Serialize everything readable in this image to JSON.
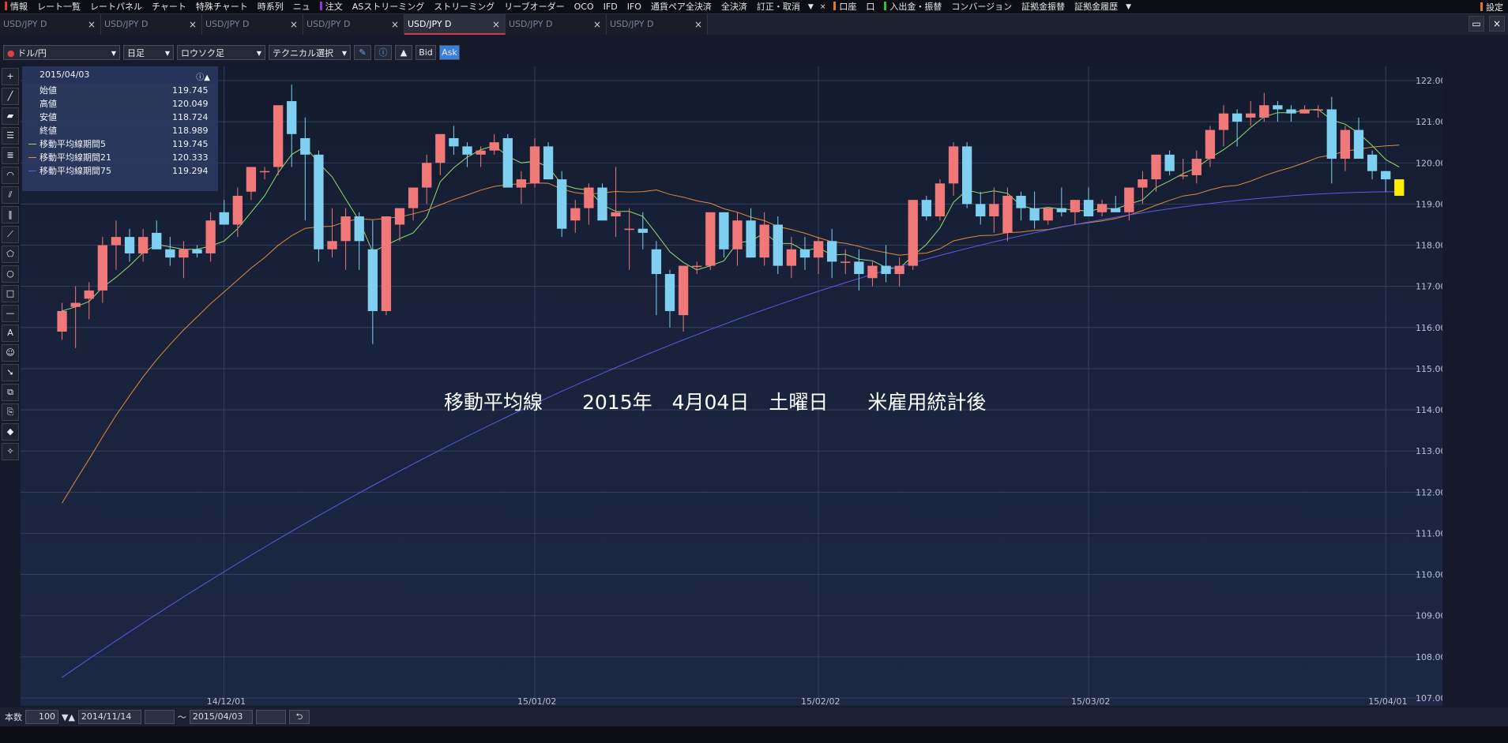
{
  "menubar": {
    "items": [
      {
        "label": "情報",
        "mark": "#d93b3b"
      },
      {
        "label": "レート一覧"
      },
      {
        "label": "レートパネル"
      },
      {
        "label": "チャート"
      },
      {
        "label": "特殊チャート"
      },
      {
        "label": "時系列"
      },
      {
        "label": "ニュ"
      },
      {
        "label": "注文",
        "mark": "#8a38d9"
      },
      {
        "label": "ASストリーミング"
      },
      {
        "label": "ストリーミング"
      },
      {
        "label": "リーブオーダー"
      },
      {
        "label": "OCO"
      },
      {
        "label": "IFD"
      },
      {
        "label": "IFO"
      },
      {
        "label": "通貨ペア全決済"
      },
      {
        "label": "全決済"
      },
      {
        "label": "訂正・取消"
      },
      {
        "label": "口座",
        "mark": "#e07a20"
      },
      {
        "label": "口"
      },
      {
        "label": "入出金・振替",
        "mark": "#2fbf3a"
      },
      {
        "label": "コンバージョン"
      },
      {
        "label": "証拠金振替"
      },
      {
        "label": "証拠金履歴"
      }
    ],
    "settings_label": "設定",
    "close_glyph": "×",
    "arrow_glyph": "▼"
  },
  "tabs": [
    {
      "label": "USD/JPY D",
      "active": false
    },
    {
      "label": "USD/JPY D",
      "active": false
    },
    {
      "label": "USD/JPY D",
      "active": false
    },
    {
      "label": "USD/JPY D",
      "active": false
    },
    {
      "label": "USD/JPY D",
      "active": true
    },
    {
      "label": "USD/JPY D",
      "active": false
    },
    {
      "label": "USD/JPY D",
      "active": false
    }
  ],
  "toolbar": {
    "currency": "ドル/円",
    "period": "日足",
    "chart_type": "ロウソク足",
    "technical": "テクニカル選択",
    "bid": "Bid",
    "ask": "Ask"
  },
  "info": {
    "date": "2015/04/03",
    "rows": [
      {
        "label": "始値",
        "value": "119.745"
      },
      {
        "label": "高値",
        "value": "120.049"
      },
      {
        "label": "安値",
        "value": "118.724"
      },
      {
        "label": "終値",
        "value": "118.989"
      },
      {
        "label": "移動平均線期間5",
        "value": "119.745",
        "color": "#8fdf6a"
      },
      {
        "label": "移動平均線期間21",
        "value": "120.333",
        "color": "#e08a3a"
      },
      {
        "label": "移動平均線期間75",
        "value": "119.294",
        "color": "#5a5ae6"
      }
    ]
  },
  "annotation": "移動平均線　　2015年　4月04日　土曜日　　米雇用統計後",
  "bottom": {
    "count_label": "本数",
    "count": "100",
    "from": "2014/11/14",
    "tilde": "〜",
    "to": "2015/04/03"
  },
  "chart_data": {
    "type": "candlestick",
    "symbol": "USD/JPY",
    "timeframe": "D",
    "ylim": [
      107,
      122
    ],
    "y_ticks": [
      "122.00",
      "121.00",
      "120.00",
      "119.00",
      "118.00",
      "117.00",
      "116.00",
      "115.00",
      "114.00",
      "113.00",
      "112.00",
      "111.00",
      "110.00",
      "109.00",
      "108.00",
      "107.00"
    ],
    "x_ticks": [
      {
        "label": "14/12/01",
        "index": 12
      },
      {
        "label": "15/01/02",
        "index": 35
      },
      {
        "label": "15/02/02",
        "index": 56
      },
      {
        "label": "15/03/02",
        "index": 76
      },
      {
        "label": "15/04/01",
        "index": 98
      }
    ],
    "up_color": "#f07878",
    "down_color": "#7fd0f0",
    "last_color": "#ffee00",
    "ma_colors": {
      "ma5": "#8fdf6a",
      "ma21": "#e08a3a",
      "ma75": "#5a5ae6"
    },
    "candles": [
      [
        115.9,
        116.6,
        115.7,
        116.4
      ],
      [
        116.5,
        117.0,
        115.5,
        116.6
      ],
      [
        116.7,
        117.1,
        116.2,
        116.9
      ],
      [
        116.9,
        118.2,
        116.6,
        118.0
      ],
      [
        118.0,
        118.6,
        117.4,
        118.2
      ],
      [
        118.2,
        118.4,
        117.6,
        117.8
      ],
      [
        117.8,
        118.4,
        117.6,
        118.2
      ],
      [
        118.3,
        118.6,
        117.9,
        117.9
      ],
      [
        117.9,
        118.2,
        117.5,
        117.7
      ],
      [
        117.7,
        118.1,
        117.2,
        117.9
      ],
      [
        117.9,
        118.0,
        117.7,
        117.8
      ],
      [
        117.8,
        118.8,
        117.6,
        118.6
      ],
      [
        118.8,
        119.1,
        118.5,
        118.5
      ],
      [
        118.5,
        119.4,
        118.2,
        119.2
      ],
      [
        119.3,
        119.9,
        119.1,
        119.9
      ],
      [
        119.8,
        119.9,
        119.6,
        119.8
      ],
      [
        119.9,
        121.4,
        119.7,
        121.4
      ],
      [
        121.5,
        121.9,
        119.9,
        120.7
      ],
      [
        120.6,
        121.1,
        118.6,
        120.2
      ],
      [
        120.2,
        120.3,
        117.6,
        117.9
      ],
      [
        117.9,
        118.9,
        117.7,
        118.1
      ],
      [
        118.1,
        118.9,
        117.4,
        118.7
      ],
      [
        118.7,
        118.8,
        117.4,
        118.1
      ],
      [
        117.9,
        118.6,
        115.6,
        116.4
      ],
      [
        116.4,
        118.7,
        116.3,
        118.7
      ],
      [
        118.5,
        118.9,
        118.1,
        118.9
      ],
      [
        118.9,
        119.1,
        118.6,
        119.4
      ],
      [
        119.4,
        120.2,
        119.0,
        120.0
      ],
      [
        120.0,
        120.7,
        119.7,
        120.7
      ],
      [
        120.6,
        120.9,
        120.2,
        120.4
      ],
      [
        120.4,
        120.5,
        119.9,
        120.2
      ],
      [
        120.2,
        120.4,
        119.9,
        120.3
      ],
      [
        120.3,
        120.7,
        120.2,
        120.5
      ],
      [
        120.6,
        120.7,
        119.5,
        119.4
      ],
      [
        119.4,
        119.8,
        119.0,
        119.6
      ],
      [
        119.5,
        120.6,
        119.4,
        120.4
      ],
      [
        120.4,
        120.5,
        119.6,
        119.6
      ],
      [
        119.6,
        119.8,
        118.2,
        118.4
      ],
      [
        118.6,
        119.1,
        118.3,
        118.9
      ],
      [
        118.9,
        119.5,
        118.5,
        119.4
      ],
      [
        119.4,
        119.5,
        118.6,
        118.6
      ],
      [
        118.7,
        119.9,
        118.2,
        118.8
      ],
      [
        118.4,
        118.9,
        117.4,
        118.4
      ],
      [
        118.4,
        118.8,
        117.9,
        118.3
      ],
      [
        117.9,
        118.1,
        116.3,
        117.3
      ],
      [
        117.3,
        117.4,
        116.0,
        116.4
      ],
      [
        116.3,
        117.5,
        115.9,
        117.5
      ],
      [
        117.5,
        117.6,
        117.3,
        117.5
      ],
      [
        117.5,
        118.8,
        117.4,
        118.8
      ],
      [
        118.8,
        118.8,
        117.7,
        117.9
      ],
      [
        117.9,
        118.8,
        117.5,
        118.6
      ],
      [
        118.6,
        118.9,
        117.7,
        117.7
      ],
      [
        117.7,
        118.8,
        117.5,
        118.5
      ],
      [
        118.5,
        118.7,
        117.3,
        117.5
      ],
      [
        117.5,
        118.2,
        117.2,
        117.9
      ],
      [
        117.9,
        118.2,
        117.4,
        117.7
      ],
      [
        117.7,
        118.2,
        117.3,
        118.1
      ],
      [
        118.1,
        118.4,
        117.2,
        117.6
      ],
      [
        117.6,
        117.9,
        117.3,
        117.6
      ],
      [
        117.6,
        117.9,
        116.9,
        117.3
      ],
      [
        117.2,
        117.6,
        117.0,
        117.5
      ],
      [
        117.5,
        118.0,
        117.1,
        117.3
      ],
      [
        117.3,
        117.7,
        117.0,
        117.5
      ],
      [
        117.5,
        119.1,
        117.4,
        119.1
      ],
      [
        119.1,
        119.2,
        118.6,
        118.7
      ],
      [
        118.7,
        119.6,
        118.6,
        119.5
      ],
      [
        119.5,
        120.5,
        119.2,
        120.4
      ],
      [
        120.4,
        120.5,
        118.9,
        119.0
      ],
      [
        119.0,
        119.3,
        118.5,
        118.7
      ],
      [
        118.7,
        119.4,
        118.3,
        119.0
      ],
      [
        118.3,
        119.4,
        118.1,
        119.2
      ],
      [
        119.2,
        119.3,
        118.6,
        118.9
      ],
      [
        118.9,
        119.3,
        118.4,
        118.6
      ],
      [
        118.6,
        118.9,
        118.5,
        118.9
      ],
      [
        118.9,
        119.4,
        118.7,
        118.8
      ],
      [
        118.8,
        119.1,
        118.5,
        119.1
      ],
      [
        119.1,
        119.4,
        118.7,
        118.7
      ],
      [
        118.8,
        119.1,
        118.7,
        119.0
      ],
      [
        118.9,
        119.2,
        118.8,
        118.8
      ],
      [
        118.8,
        119.4,
        118.6,
        119.4
      ],
      [
        119.4,
        119.8,
        119.0,
        119.6
      ],
      [
        119.6,
        120.2,
        119.3,
        120.2
      ],
      [
        120.2,
        120.3,
        119.7,
        119.8
      ],
      [
        119.7,
        120.1,
        119.6,
        119.7
      ],
      [
        119.7,
        120.3,
        119.5,
        120.1
      ],
      [
        120.1,
        120.9,
        119.9,
        120.8
      ],
      [
        120.8,
        121.4,
        120.4,
        121.2
      ],
      [
        121.2,
        121.3,
        120.4,
        121.0
      ],
      [
        121.1,
        121.5,
        120.9,
        121.2
      ],
      [
        121.1,
        121.7,
        121.0,
        121.4
      ],
      [
        121.4,
        121.5,
        121.0,
        121.3
      ],
      [
        121.3,
        121.4,
        121.0,
        121.2
      ],
      [
        121.2,
        121.4,
        121.2,
        121.3
      ],
      [
        121.3,
        121.4,
        121.1,
        121.3
      ],
      [
        121.3,
        121.6,
        119.5,
        120.1
      ],
      [
        120.1,
        120.9,
        119.8,
        120.8
      ],
      [
        120.8,
        121.1,
        120.1,
        120.1
      ],
      [
        120.2,
        120.3,
        119.6,
        119.8
      ],
      [
        119.8,
        119.8,
        119.3,
        119.6
      ],
      [
        119.6,
        119.6,
        119.2,
        119.2
      ]
    ]
  }
}
